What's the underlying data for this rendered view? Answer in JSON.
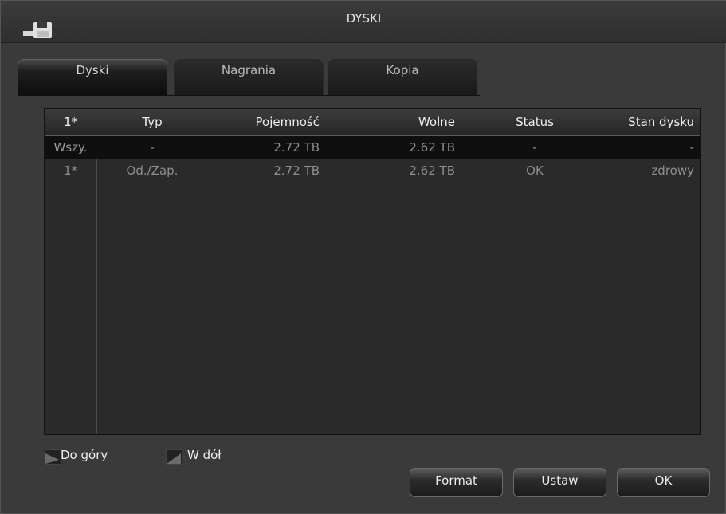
{
  "window": {
    "title": "DYSKI",
    "icon": "disk-icon"
  },
  "tabs": [
    {
      "label": "Dyski",
      "active": true
    },
    {
      "label": "Nagrania",
      "active": false
    },
    {
      "label": "Kopia",
      "active": false
    }
  ],
  "table": {
    "headers": [
      "1*",
      "Typ",
      "Pojemność",
      "Wolne",
      "Status",
      "Stan dysku"
    ],
    "rows": [
      {
        "id": "Wszy.",
        "typ": "-",
        "pojemnosc": "2.72 TB",
        "wolne": "2.62 TB",
        "status": "-",
        "stan": "-"
      },
      {
        "id": "1*",
        "typ": "Od./Zap.",
        "pojemnosc": "2.72 TB",
        "wolne": "2.62 TB",
        "status": "OK",
        "stan": "zdrowy"
      }
    ]
  },
  "nav": {
    "up_label": "Do góry",
    "down_label": "W dół"
  },
  "buttons": {
    "format": "Format",
    "set": "Ustaw",
    "ok": "OK"
  }
}
